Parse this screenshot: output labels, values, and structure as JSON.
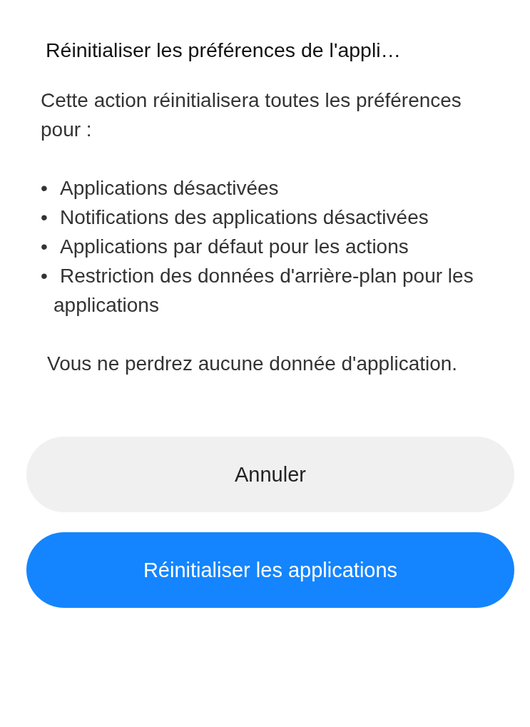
{
  "dialog": {
    "title": "Réinitialiser les préférences de l'appli…",
    "intro": "Cette action réinitialisera toutes les préférences pour :",
    "items": [
      {
        "bullet": "•",
        "text": "Applications désactivées"
      },
      {
        "bullet": "•",
        "text": "Notifications des applications désactivées"
      },
      {
        "bullet": "•",
        "text": "Applications par défaut pour les actions"
      },
      {
        "bullet": "•",
        "text": "Restriction des données d'arrière-plan pour les applications"
      }
    ],
    "note": "Vous ne perdrez aucune donnée d'application.",
    "buttons": [
      {
        "label": "Annuler",
        "kind": "secondary"
      },
      {
        "label": "Réinitialiser les applications",
        "kind": "primary"
      }
    ]
  }
}
